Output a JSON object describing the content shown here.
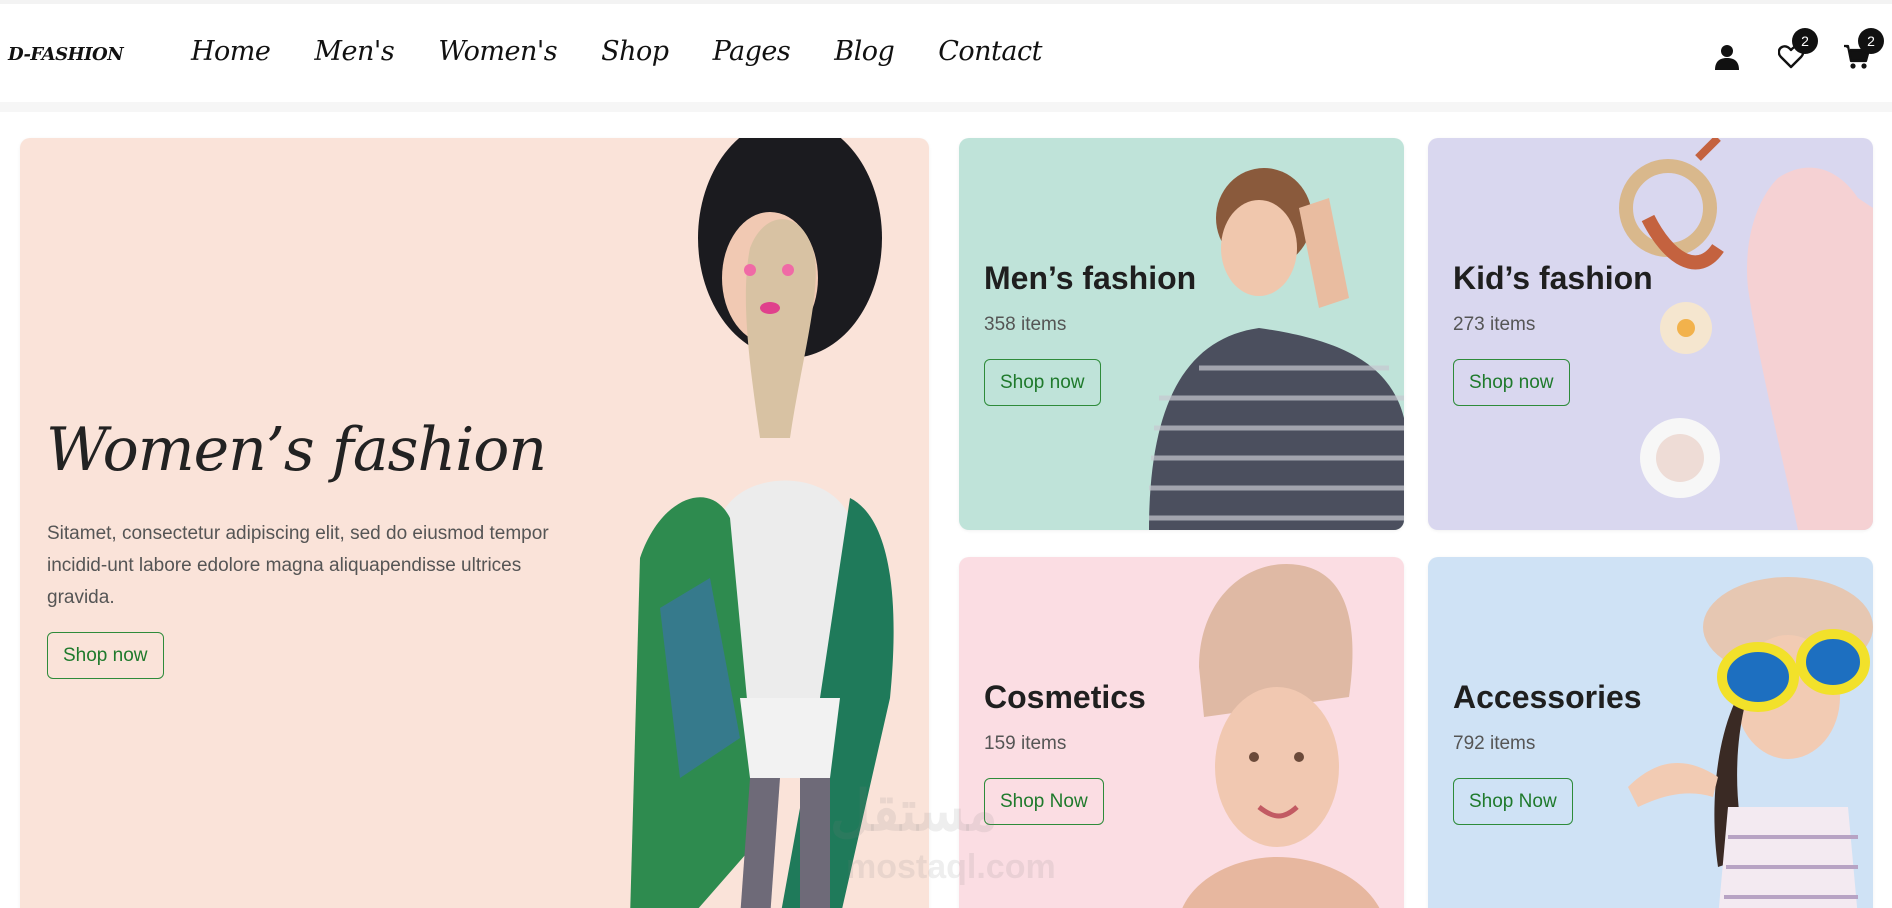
{
  "brand": {
    "logo": "D-FASHION"
  },
  "nav": {
    "items": [
      {
        "label": "Home"
      },
      {
        "label": "Men's"
      },
      {
        "label": "Women's"
      },
      {
        "label": "Shop"
      },
      {
        "label": "Pages"
      },
      {
        "label": "Blog"
      },
      {
        "label": "Contact"
      }
    ]
  },
  "header_icons": {
    "user": {
      "icon": "user-icon"
    },
    "wishlist": {
      "icon": "heart-icon",
      "count": "2"
    },
    "cart": {
      "icon": "cart-icon",
      "count": "2"
    }
  },
  "hero": {
    "title": "Women’s fashion",
    "description": "Sitamet, consectetur adipiscing elit, sed do eiusmod tempor incidid-unt labore edolore magna aliquapendisse ultrices gravida.",
    "button": "Shop now",
    "bg_color": "#fae3d9"
  },
  "categories": [
    {
      "title": "Men’s fashion",
      "count": "358 items",
      "button": "Shop now",
      "bg_color": "#bfe3d9"
    },
    {
      "title": "Kid’s fashion",
      "count": "273 items",
      "button": "Shop now",
      "bg_color": "#d9d7ef"
    },
    {
      "title": "Cosmetics",
      "count": "159 items",
      "button": "Shop Now",
      "bg_color": "#fbdde3"
    },
    {
      "title": "Accessories",
      "count": "792 items",
      "button": "Shop Now",
      "bg_color": "#cfe2f5"
    }
  ],
  "watermark": {
    "line1": "مستقل",
    "line2": "mostaql.com"
  },
  "colors": {
    "accent": "#2e8b3a",
    "text": "#222222"
  }
}
